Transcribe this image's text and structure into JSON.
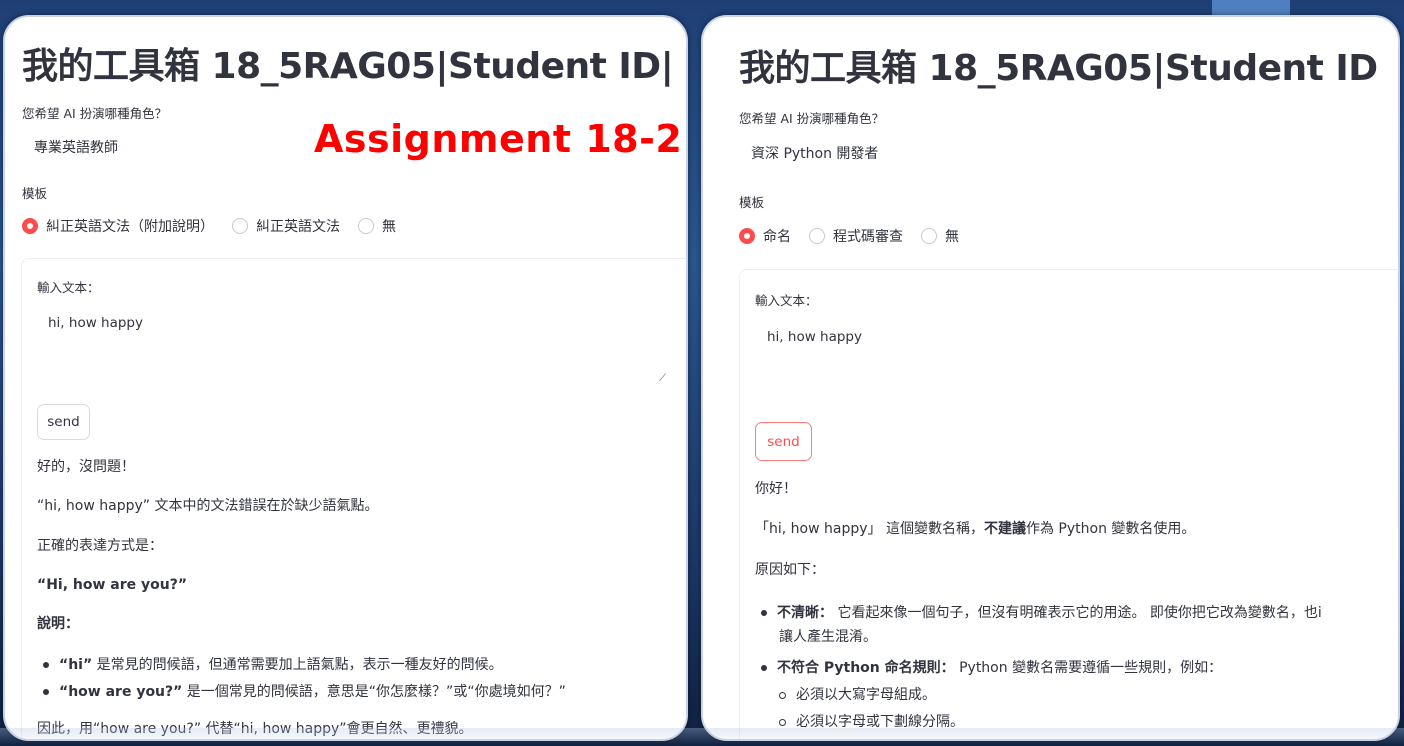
{
  "overlay": {
    "assignment_label": "Assignment 18-2"
  },
  "left": {
    "title": "我的工具箱 18_5RAG05|Student ID|",
    "role_label": "您希望 AI 扮演哪種角色？",
    "role_value": "專業英語教師",
    "template_label": "模板",
    "templates": [
      "糾正英語文法（附加說明）",
      "糾正英語文法",
      "無"
    ],
    "selected_template_index": 0,
    "input_label": "輸入文本：",
    "input_value": "hi, how happy",
    "send_label": "send",
    "response": {
      "greeting": "好的，沒問題！",
      "line1": "“hi, how happy” 文本中的文法錯誤在於缺少語氣點。",
      "line2": "正確的表達方式是：",
      "line3": "“Hi, how are you?”",
      "heading": "說明：",
      "bullet1_bold": "“hi”",
      "bullet1_rest": " 是常見的問候語，但通常需要加上語氣點，表示一種友好的問候。",
      "bullet2_bold": "“how are you?”",
      "bullet2_rest": " 是一個常見的問候語，意思是“你怎麼樣？”或“你處境如何？”",
      "cut_line": "因此，用“how are you?” 代替“hi, how happy”會更自然、更禮貌。"
    }
  },
  "right": {
    "title": "我的工具箱 18_5RAG05|Student ID",
    "role_label": "您希望 AI 扮演哪種角色？",
    "role_value": "資深 Python 開發者",
    "template_label": "模板",
    "templates": [
      "命名",
      "程式碼審查",
      "無"
    ],
    "selected_template_index": 0,
    "input_label": "輸入文本：",
    "input_value": "hi, how happy",
    "send_label": "send",
    "response": {
      "greeting": "你好！",
      "line1_pre": "「hi, how happy」 這個變數名稱，",
      "line1_bold": "不建議",
      "line1_post": "作為 Python 變數名使用。",
      "line2": "原因如下：",
      "bullet1_bold": "不清晰：",
      "bullet1_rest": " 它看起來像一個句子，但沒有明確表示它的用途。 即使你把它改為變數名，也i",
      "bullet1_cont": "讓人產生混淆。",
      "bullet2_bold": "不符合 Python 命名規則：",
      "bullet2_rest": " Python 變數名需要遵循一些規則，例如：",
      "sub1": "必須以大寫字母組成。",
      "sub2_cut": "必須以字母或下劃線分隔。"
    }
  },
  "colors": {
    "accent": "#ff4b4b",
    "assignment_red": "#ff0000",
    "text": "#31333f"
  }
}
